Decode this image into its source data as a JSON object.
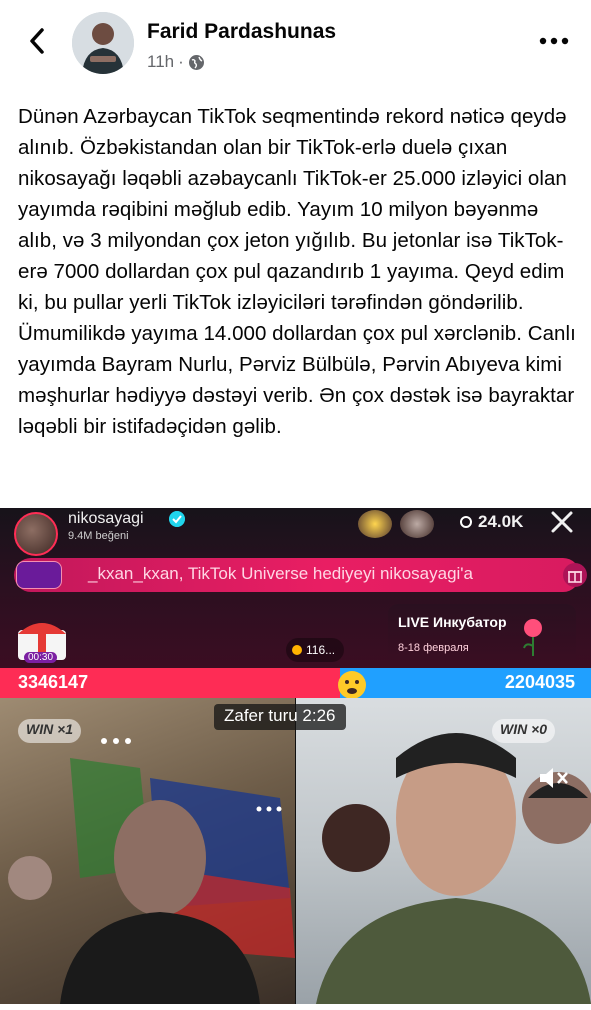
{
  "header": {
    "author": "Farid Pardashunas",
    "timestamp": "11h",
    "separator": "·",
    "back_icon": "chevron-left-icon",
    "privacy_icon": "globe-icon",
    "more_icon": "ellipsis-icon"
  },
  "post": {
    "text": "Dünən Azərbaycan TikTok seqmentində rekord nəticə qeydə alınıb. Özbəkistandan olan bir TikTok-erlə duelə çıxan nikosayağı ləqəbli azəbaycanlı TikTok-er 25.000 izləyici olan yayımda rəqibini məğlub edib. Yayım 10 milyon bəyənmə alıb, və 3 milyondan çox jeton yığılıb. Bu jetonlar isə TikTok-erə 7000 dollardan çox pul qazandırıb 1 yayıma. Qeyd edim ki, bu pullar yerli TikTok izləyiciləri tərəfindən göndərilib. Ümumilikdə yayıma 14.000 dollardan çox pul xərclənib. Canlı yayımda Bayram Nurlu, Pərviz Bülbülə, Pərvin Abıyeva kimi məşhurlar hədiyyə dəstəyi verib. Ən çox dəstək isə bayraktar ləqəbli bir istifadəçidən gəlib."
  },
  "live": {
    "host_name": "nikosayagi",
    "host_likes": "9.4M beğeni",
    "viewer_count": "24.0K",
    "gift_banner": "_kxan_kxan, TikTok Universe hediyeyi nikosayagi'a",
    "chest_timer": "00:30",
    "pill_value": "116...",
    "incubator_title": "LIVE Инкубатор",
    "incubator_dates": "8-18 февраля",
    "score_left": "3346147",
    "score_right": "2204035",
    "round_label": "Zafer turu  2:26",
    "win_left": "WIN ×1",
    "win_right": "WIN ×0",
    "colors": {
      "red": "#fe2c55",
      "blue": "#20a0ff",
      "banner": "#e91e63"
    }
  }
}
